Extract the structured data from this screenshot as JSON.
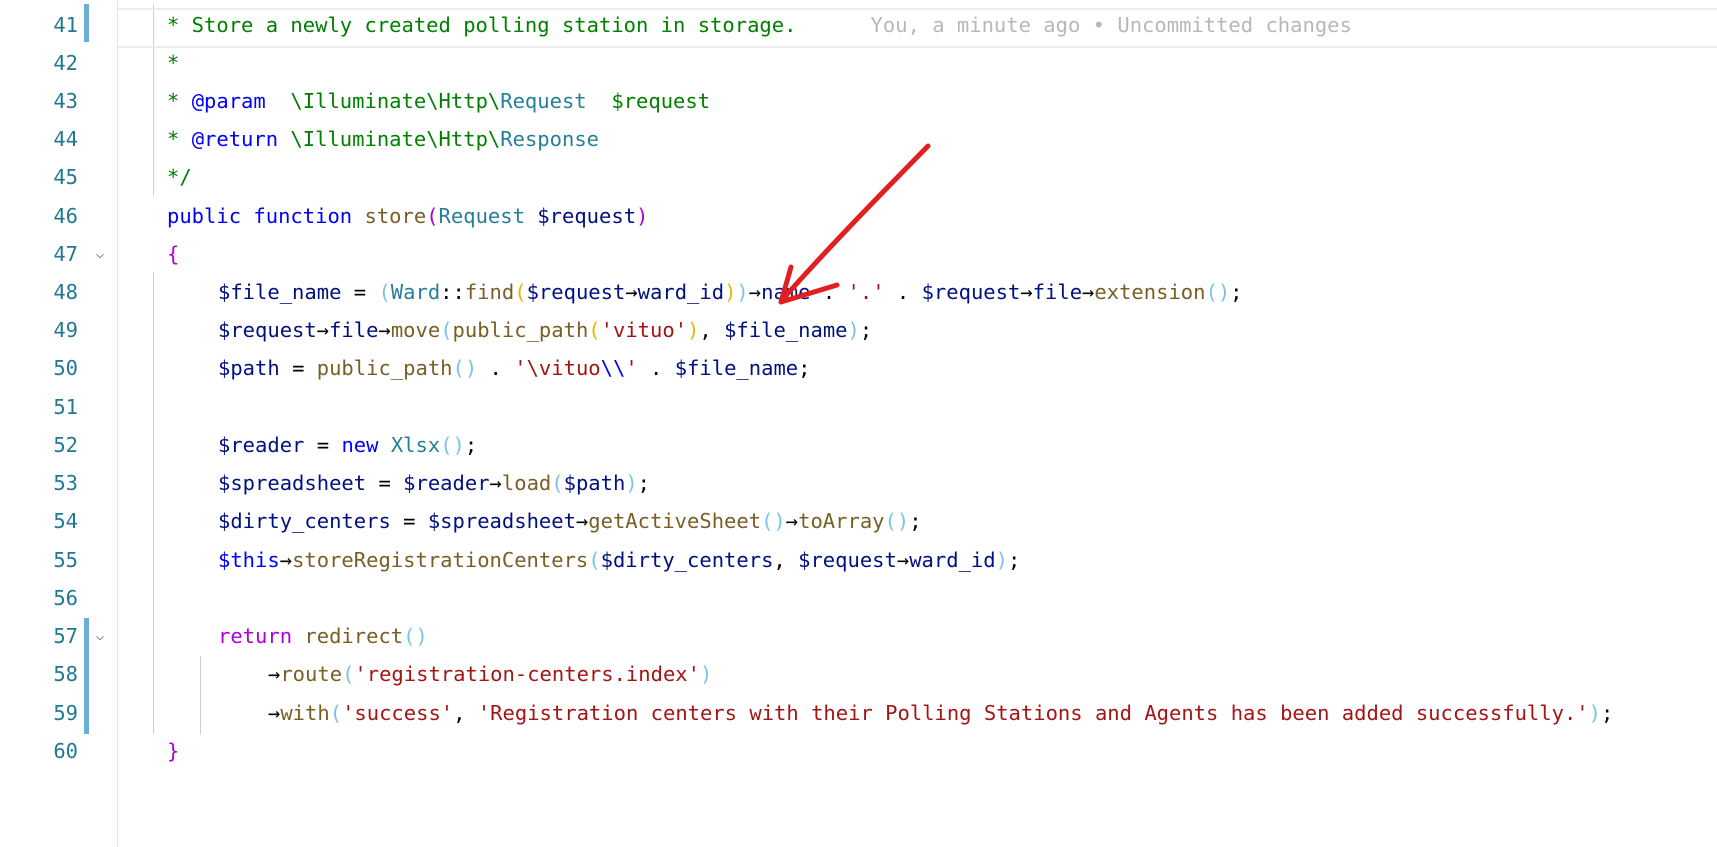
{
  "blame": "You, a minute ago • Uncommitted changes",
  "lines": [
    {
      "num": "41",
      "text": "* Store a newly created polling station in storage."
    },
    {
      "num": "42",
      "text": "*"
    },
    {
      "num": "43",
      "text": "* @param  \\Illuminate\\Http\\Request  $request"
    },
    {
      "num": "44",
      "text": "* @return \\Illuminate\\Http\\Response"
    },
    {
      "num": "45",
      "text": "*/"
    },
    {
      "num": "46",
      "text": "public function store(Request $request)"
    },
    {
      "num": "47",
      "text": "{"
    },
    {
      "num": "48",
      "text": "$file_name = (Ward::find($request→ward_id))→name . '.' . $request→file→extension();"
    },
    {
      "num": "49",
      "text": "$request→file→move(public_path('vituo'), $file_name);"
    },
    {
      "num": "50",
      "text": "$path = public_path() . '\\vituo\\\\' . $file_name;"
    },
    {
      "num": "51",
      "text": ""
    },
    {
      "num": "52",
      "text": "$reader = new Xlsx();"
    },
    {
      "num": "53",
      "text": "$spreadsheet = $reader→load($path);"
    },
    {
      "num": "54",
      "text": "$dirty_centers = $spreadsheet→getActiveSheet()→toArray();"
    },
    {
      "num": "55",
      "text": "$this→storeRegistrationCenters($dirty_centers, $request→ward_id);"
    },
    {
      "num": "56",
      "text": ""
    },
    {
      "num": "57",
      "text": "return redirect()"
    },
    {
      "num": "58",
      "text": "→route('registration-centers.index')"
    },
    {
      "num": "59",
      "text": "→with('success', 'Registration centers with their Polling Stations and Agents has been added successfully.');"
    },
    {
      "num": "60",
      "text": "}"
    }
  ],
  "colors": {
    "comment": "#008000",
    "keyword": "#0000ff",
    "class": "#267f99",
    "function": "#795e26",
    "variable": "#001080",
    "string": "#a31515",
    "line_number": "#237893",
    "annotation_arrow": "#e02020"
  },
  "icons": {
    "fold": "chevron-down-icon",
    "annotation": "red-arrow-annotation"
  }
}
